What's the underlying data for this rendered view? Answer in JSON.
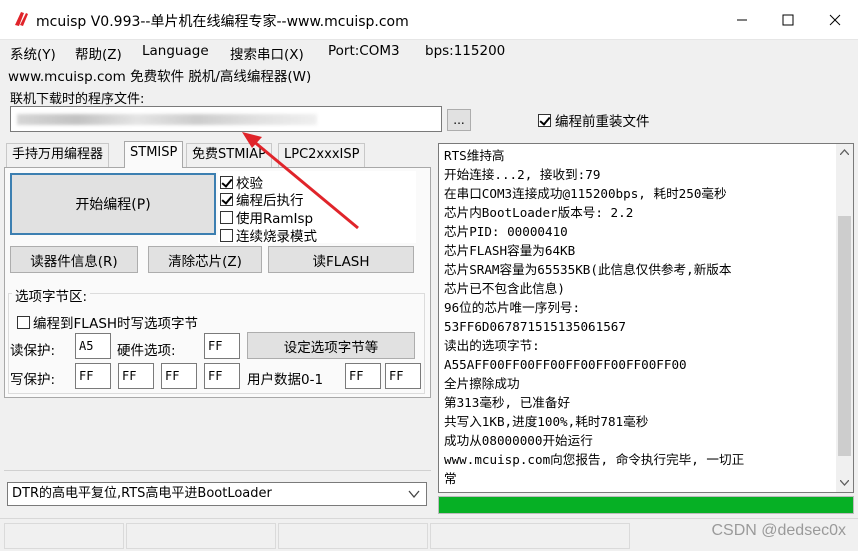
{
  "window": {
    "title": "mcuisp V0.993--单片机在线编程专家--www.mcuisp.com"
  },
  "menu": {
    "items": [
      "系统(Y)",
      "帮助(Z)",
      "Language",
      "搜索串口(X)",
      "Port:COM3",
      "bps:115200"
    ],
    "row2": "www.mcuisp.com 免费软件 脱机/高线编程器(W)"
  },
  "file": {
    "label": "联机下载时的程序文件:",
    "browse": "...",
    "reload_label": "编程前重装文件",
    "reload_checked": true
  },
  "tabs": [
    "手持万用编程器",
    "STMISP",
    "免费STMIAP",
    "LPC2xxxISP"
  ],
  "active_tab": 1,
  "start_button": "开始编程(P)",
  "options": [
    {
      "label": "校验",
      "checked": true
    },
    {
      "label": "编程后执行",
      "checked": true
    },
    {
      "label": "使用RamIsp",
      "checked": false
    },
    {
      "label": "连续烧录模式",
      "checked": false
    }
  ],
  "buttons": {
    "read_info": "读器件信息(R)",
    "erase": "清除芯片(Z)",
    "read_flash": "读FLASH"
  },
  "option_bytes": {
    "group_title": "选项字节区:",
    "write_check_label": "编程到FLASH时写选项字节",
    "read_protect_label": "读保护:",
    "read_protect_value": "A5",
    "hw_option_label": "硬件选项:",
    "hw_option_value": "FF",
    "set_button": "设定选项字节等",
    "write_protect_label": "写保护:",
    "write_protect_values": [
      "FF",
      "FF",
      "FF",
      "FF"
    ],
    "user_data_label": "用户数据0-1",
    "user_data_values": [
      "FF",
      "FF"
    ]
  },
  "combo": {
    "selected": "DTR的高电平复位,RTS高电平进BootLoader"
  },
  "log": {
    "lines": [
      "RTS维持高",
      "开始连接...2, 接收到:79",
      "在串口COM3连接成功@115200bps, 耗时250毫秒",
      "芯片内BootLoader版本号: 2.2",
      "芯片PID: 00000410",
      "芯片FLASH容量为64KB",
      "芯片SRAM容量为65535KB(此信息仅供参考,新版本",
      "芯片已不包含此信息)",
      "96位的芯片唯一序列号:",
      "53FF6D067871515135061567",
      "读出的选项字节:",
      "A55AFF00FF00FF00FF00FF00FF00FF00",
      "全片擦除成功",
      "第313毫秒, 已准备好",
      "共写入1KB,进度100%,耗时781毫秒",
      "成功从08000000开始运行",
      "www.mcuisp.com向您报告, 命令执行完毕, 一切正",
      "常"
    ]
  },
  "progress": {
    "percent": 100,
    "color": "#06b025"
  },
  "watermark": "CSDN @dedsec0x",
  "colors": {
    "accent": "#3c7fb1",
    "arrow": "#e0242a"
  }
}
